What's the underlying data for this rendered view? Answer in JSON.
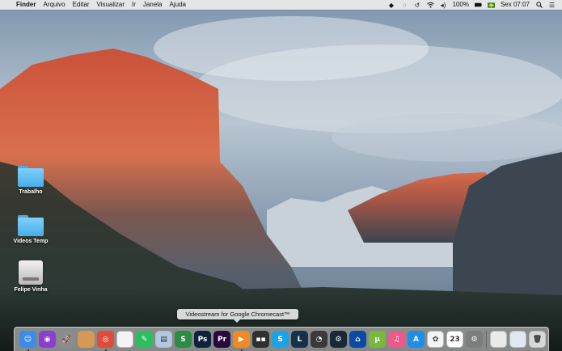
{
  "menubar": {
    "apple_glyph": "",
    "items": [
      "Finder",
      "Arquivo",
      "Editar",
      "Visualizar",
      "Ir",
      "Janela",
      "Ajuda"
    ],
    "status": {
      "battery": "100%",
      "clock": "Sex 07:07"
    }
  },
  "desktop": {
    "icons": [
      {
        "label": "Trabalho",
        "kind": "folder"
      },
      {
        "label": "Videos Temp",
        "kind": "folder"
      },
      {
        "label": "Felipe Vinha",
        "kind": "hard-drive"
      }
    ]
  },
  "tooltip": {
    "text": "Videostream for Google Chromecast™"
  },
  "dock": {
    "items": [
      {
        "name": "finder",
        "glyph": "☺",
        "color": "#3c8ce8",
        "running": true
      },
      {
        "name": "siri",
        "glyph": "◉",
        "color": "#8a3fd1",
        "running": false
      },
      {
        "name": "launchpad",
        "glyph": "🚀",
        "color": "#8c8c8c",
        "running": false
      },
      {
        "name": "notes",
        "glyph": "",
        "color": "#d49a54",
        "running": false
      },
      {
        "name": "chrome",
        "glyph": "◎",
        "color": "#e04b3a",
        "running": true
      },
      {
        "name": "document",
        "glyph": "",
        "color": "#f4f4f4",
        "running": false
      },
      {
        "name": "evernote",
        "glyph": "✎",
        "color": "#2dbe60",
        "running": false
      },
      {
        "name": "preview",
        "glyph": "▤",
        "color": "#b0c8e0",
        "running": false
      },
      {
        "name": "slides",
        "glyph": "S",
        "color": "#2c8c46",
        "running": false
      },
      {
        "name": "photoshop",
        "glyph": "Ps",
        "color": "#0e2339",
        "running": false
      },
      {
        "name": "premiere",
        "glyph": "Pr",
        "color": "#2a0a3b",
        "running": false
      },
      {
        "name": "videostream",
        "glyph": "▶",
        "color": "#f08a24",
        "running": true
      },
      {
        "name": "audio-app",
        "glyph": "▪▪",
        "color": "#303030",
        "running": false
      },
      {
        "name": "skype",
        "glyph": "S",
        "color": "#1ba3e3",
        "running": false
      },
      {
        "name": "lightroom",
        "glyph": "L",
        "color": "#17314a",
        "running": false
      },
      {
        "name": "camera-app",
        "glyph": "◔",
        "color": "#3a3a3a",
        "running": false
      },
      {
        "name": "steam",
        "glyph": "⚙",
        "color": "#1b2838",
        "running": false
      },
      {
        "name": "ps-remote",
        "glyph": "⌂",
        "color": "#0b4aa0",
        "running": false
      },
      {
        "name": "utorrent",
        "glyph": "μ",
        "color": "#78b83c",
        "running": false
      },
      {
        "name": "itunes",
        "glyph": "♫",
        "color": "#ea5a8a",
        "running": false
      },
      {
        "name": "app-store",
        "glyph": "A",
        "color": "#1e8ee8",
        "running": false
      },
      {
        "name": "photos",
        "glyph": "✿",
        "color": "#f3f3f3",
        "running": false
      },
      {
        "name": "calendar",
        "glyph": "23",
        "color": "#ffffff",
        "running": false
      },
      {
        "name": "system-preferences",
        "glyph": "⚙",
        "color": "#7d7d7d",
        "running": false
      },
      {
        "name": "downloads-stack",
        "glyph": "",
        "color": "#eaeaea",
        "running": false
      },
      {
        "name": "documents-stack",
        "glyph": "",
        "color": "#dfe8f0",
        "running": false
      },
      {
        "name": "trash",
        "glyph": "🗑",
        "color": "#d8d8d8",
        "running": false
      }
    ]
  }
}
